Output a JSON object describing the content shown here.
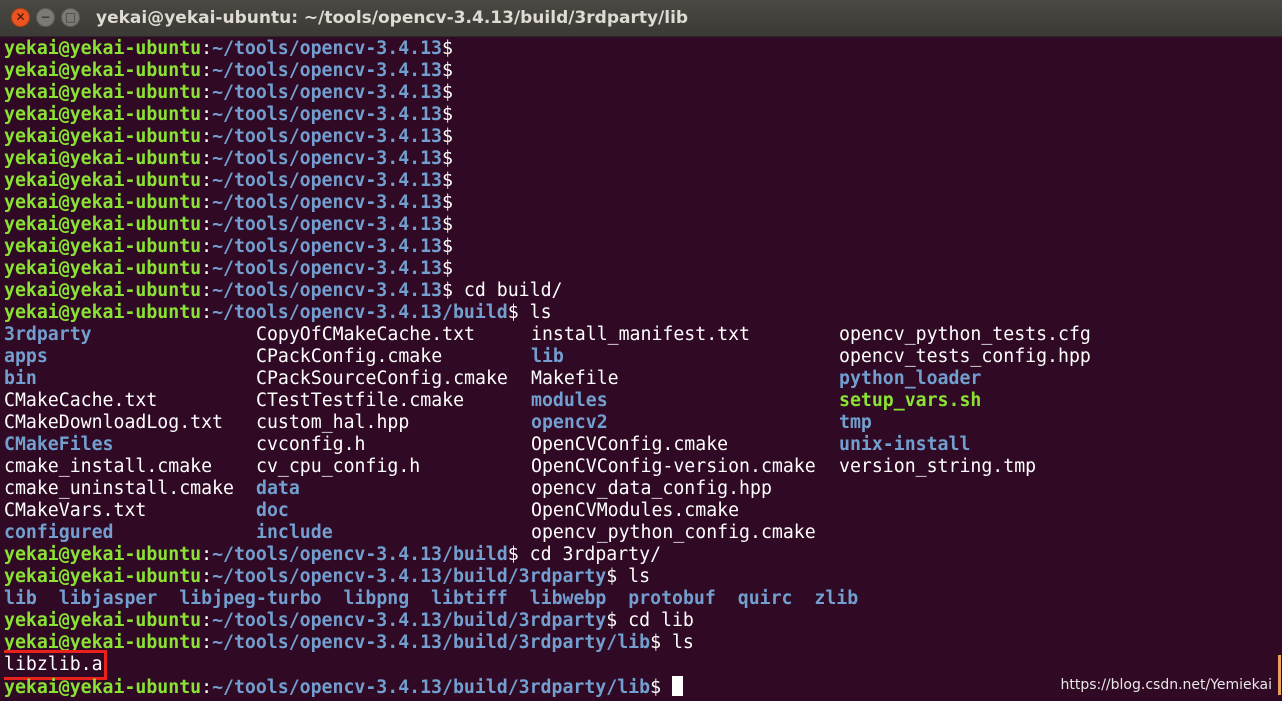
{
  "window": {
    "title": "yekai@yekai-ubuntu: ~/tools/opencv-3.4.13/build/3rdparty/lib",
    "close_glyph": "✕",
    "minimize_glyph": "−",
    "maximize_glyph": "□"
  },
  "terminal": {
    "prompt_user": "yekai@yekai-ubuntu",
    "prompt_sep": ":",
    "empty_prompts_path": "~/tools/opencv-3.4.13",
    "prompt_dollar": "$",
    "lines": [
      {
        "path": "~/tools/opencv-3.4.13",
        "cmd": ""
      },
      {
        "path": "~/tools/opencv-3.4.13",
        "cmd": ""
      },
      {
        "path": "~/tools/opencv-3.4.13",
        "cmd": ""
      },
      {
        "path": "~/tools/opencv-3.4.13",
        "cmd": ""
      },
      {
        "path": "~/tools/opencv-3.4.13",
        "cmd": ""
      },
      {
        "path": "~/tools/opencv-3.4.13",
        "cmd": ""
      },
      {
        "path": "~/tools/opencv-3.4.13",
        "cmd": ""
      },
      {
        "path": "~/tools/opencv-3.4.13",
        "cmd": ""
      },
      {
        "path": "~/tools/opencv-3.4.13",
        "cmd": ""
      },
      {
        "path": "~/tools/opencv-3.4.13",
        "cmd": ""
      },
      {
        "path": "~/tools/opencv-3.4.13",
        "cmd": ""
      },
      {
        "path": "~/tools/opencv-3.4.13",
        "cmd": " cd build/"
      },
      {
        "path": "~/tools/opencv-3.4.13/build",
        "cmd": " ls"
      }
    ],
    "build_ls_columns": [
      [
        {
          "name": "3rdparty",
          "type": "dir"
        },
        {
          "name": "apps",
          "type": "dir"
        },
        {
          "name": "bin",
          "type": "dir"
        },
        {
          "name": "CMakeCache.txt",
          "type": "file"
        },
        {
          "name": "CMakeDownloadLog.txt",
          "type": "file"
        },
        {
          "name": "CMakeFiles",
          "type": "dir"
        },
        {
          "name": "cmake_install.cmake",
          "type": "file"
        },
        {
          "name": "cmake_uninstall.cmake",
          "type": "file"
        },
        {
          "name": "CMakeVars.txt",
          "type": "file"
        },
        {
          "name": "configured",
          "type": "dir"
        }
      ],
      [
        {
          "name": "CopyOfCMakeCache.txt",
          "type": "file"
        },
        {
          "name": "CPackConfig.cmake",
          "type": "file"
        },
        {
          "name": "CPackSourceConfig.cmake",
          "type": "file"
        },
        {
          "name": "CTestTestfile.cmake",
          "type": "file"
        },
        {
          "name": "custom_hal.hpp",
          "type": "file"
        },
        {
          "name": "cvconfig.h",
          "type": "file"
        },
        {
          "name": "cv_cpu_config.h",
          "type": "file"
        },
        {
          "name": "data",
          "type": "dir"
        },
        {
          "name": "doc",
          "type": "dir"
        },
        {
          "name": "include",
          "type": "dir"
        }
      ],
      [
        {
          "name": "install_manifest.txt",
          "type": "file"
        },
        {
          "name": "lib",
          "type": "dir"
        },
        {
          "name": "Makefile",
          "type": "file"
        },
        {
          "name": "modules",
          "type": "dir"
        },
        {
          "name": "opencv2",
          "type": "dir"
        },
        {
          "name": "OpenCVConfig.cmake",
          "type": "file"
        },
        {
          "name": "OpenCVConfig-version.cmake",
          "type": "file"
        },
        {
          "name": "opencv_data_config.hpp",
          "type": "file"
        },
        {
          "name": "OpenCVModules.cmake",
          "type": "file"
        },
        {
          "name": "opencv_python_config.cmake",
          "type": "file"
        }
      ],
      [
        {
          "name": "opencv_python_tests.cfg",
          "type": "file"
        },
        {
          "name": "opencv_tests_config.hpp",
          "type": "file"
        },
        {
          "name": "python_loader",
          "type": "dir"
        },
        {
          "name": "setup_vars.sh",
          "type": "exe"
        },
        {
          "name": "tmp",
          "type": "dir"
        },
        {
          "name": "unix-install",
          "type": "dir"
        },
        {
          "name": "version_string.tmp",
          "type": "file"
        }
      ]
    ],
    "after_lines": [
      {
        "path": "~/tools/opencv-3.4.13/build",
        "cmd": " cd 3rdparty/"
      },
      {
        "path": "~/tools/opencv-3.4.13/build/3rdparty",
        "cmd": " ls"
      }
    ],
    "thirdparty_ls": [
      "lib",
      "libjasper",
      "libjpeg-turbo",
      "libpng",
      "libtiff",
      "libwebp",
      "protobuf",
      "quirc",
      "zlib"
    ],
    "after_lines2": [
      {
        "path": "~/tools/opencv-3.4.13/build/3rdparty",
        "cmd": " cd lib"
      },
      {
        "path": "~/tools/opencv-3.4.13/build/3rdparty/lib",
        "cmd": " ls"
      }
    ],
    "lib_ls": "libzlib.a",
    "final_prompt_path": "~/tools/opencv-3.4.13/build/3rdparty/lib",
    "final_cmd": " "
  },
  "watermark": "https://blog.csdn.net/Yemiekai",
  "colors": {
    "background": "#300a24",
    "user": "#8ae234",
    "path": "#729fcf",
    "highlight_box": "#e8211c"
  }
}
